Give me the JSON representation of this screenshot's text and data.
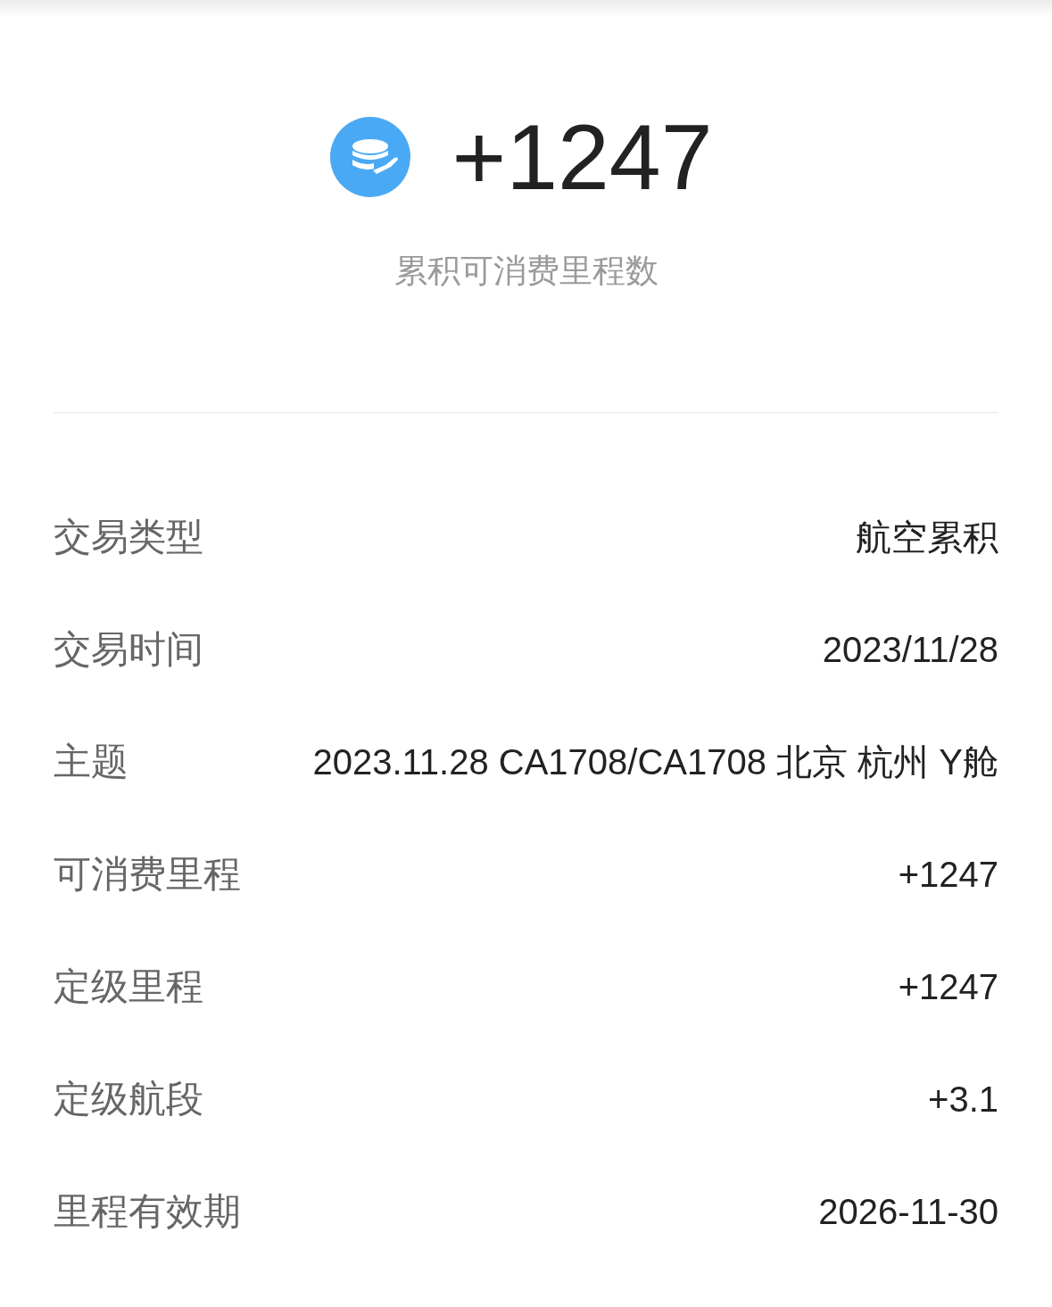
{
  "summary": {
    "amount": "+1247",
    "caption": "累积可消费里程数"
  },
  "details": [
    {
      "label": "交易类型",
      "value": "航空累积"
    },
    {
      "label": "交易时间",
      "value": "2023/11/28"
    },
    {
      "label": "主题",
      "value": "2023.11.28 CA1708/CA1708 北京 杭州 Y舱"
    },
    {
      "label": "可消费里程",
      "value": "+1247"
    },
    {
      "label": "定级里程",
      "value": "+1247"
    },
    {
      "label": "定级航段",
      "value": "+3.1"
    },
    {
      "label": "里程有效期",
      "value": "2026-11-30"
    }
  ]
}
